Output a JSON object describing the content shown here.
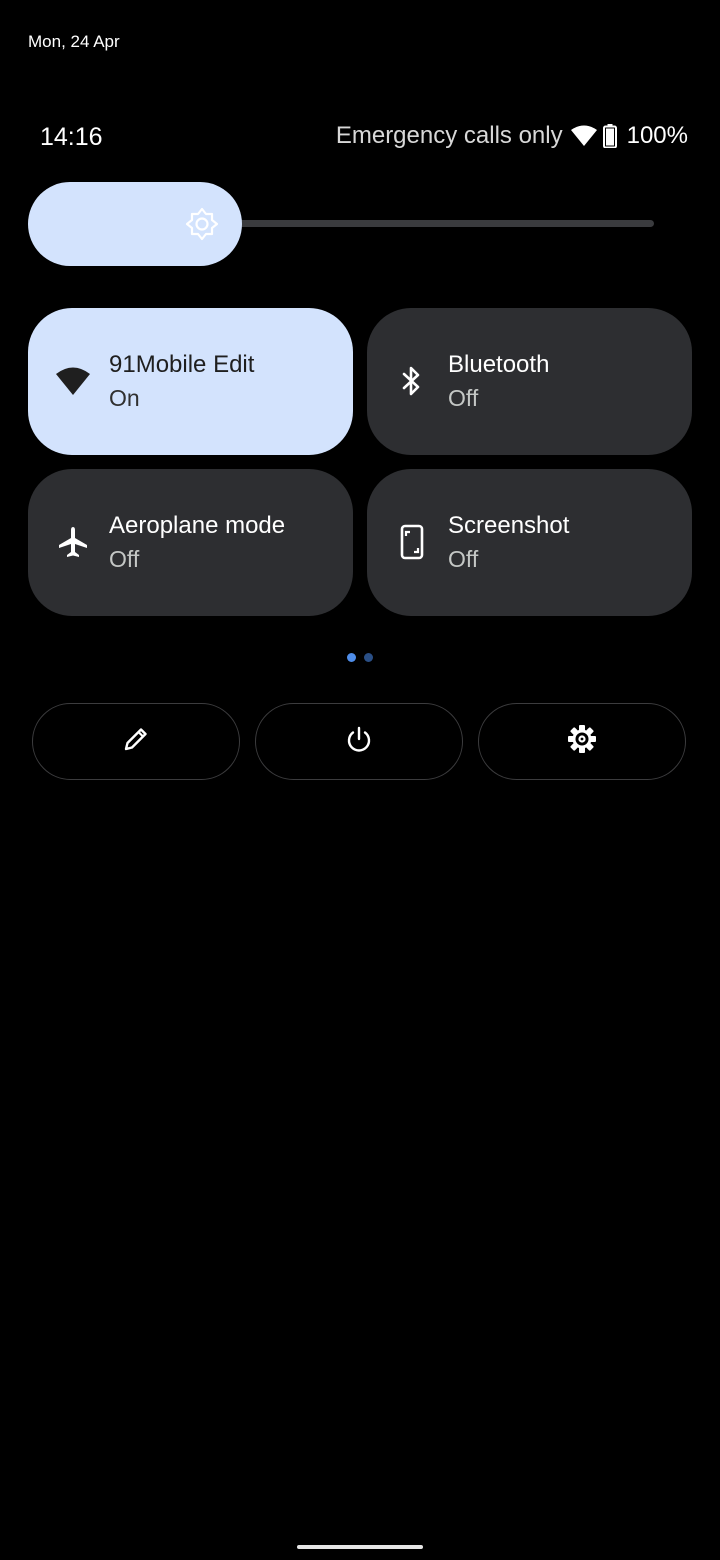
{
  "status": {
    "date": "Mon, 24 Apr",
    "time": "14:16",
    "carrier_text": "Emergency calls only",
    "battery_percent": "100%",
    "wifi_icon": "wifi-icon",
    "battery_icon": "battery-full-icon"
  },
  "brightness": {
    "level": 0.32,
    "icon": "brightness-sun-icon",
    "fill_color": "#d3e3fd"
  },
  "tiles": [
    {
      "title": "91Mobile Edit",
      "state": "On",
      "icon": "wifi-icon",
      "active": true
    },
    {
      "title": "Bluetooth",
      "state": "Off",
      "icon": "bluetooth-icon",
      "active": false
    },
    {
      "title": "Aeroplane mode",
      "state": "Off",
      "icon": "airplane-icon",
      "active": false
    },
    {
      "title": "Screenshot",
      "state": "Off",
      "icon": "screenshot-icon",
      "active": false
    }
  ],
  "pager": {
    "pages": 2,
    "current": 1
  },
  "actions": [
    {
      "icon": "edit-pencil-icon"
    },
    {
      "icon": "power-icon"
    },
    {
      "icon": "settings-gear-icon"
    }
  ],
  "colors": {
    "background": "#000000",
    "tile_off": "#2d2e31",
    "tile_on": "#d3e3fd",
    "accent_dot": "#4f8de9"
  }
}
